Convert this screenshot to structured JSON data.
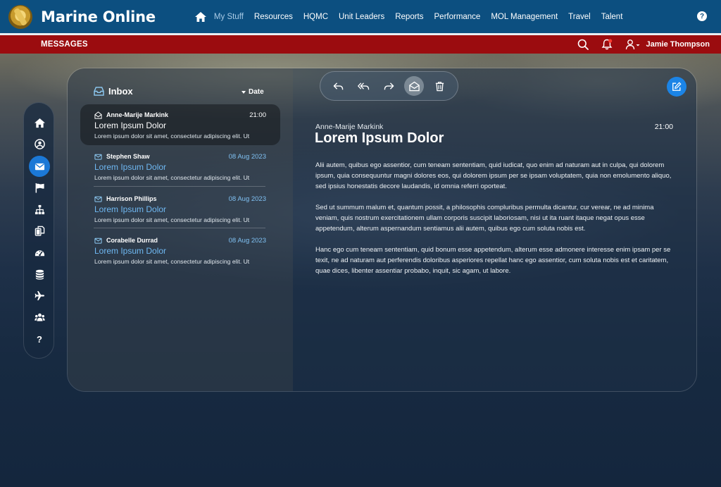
{
  "app": {
    "brand": "Marine Online",
    "nav": [
      "My Stuff",
      "Resources",
      "HQMC",
      "Unit Leaders",
      "Reports",
      "Performance",
      "MOL Management",
      "Travel",
      "Talent"
    ],
    "nav_active": "My Stuff",
    "help": "?"
  },
  "subheader": {
    "title": "MESSAGES",
    "user_name": "Jamie Thompson"
  },
  "rail": {
    "items": [
      "home-icon",
      "user-circle-icon",
      "envelope-icon",
      "flag-icon",
      "org-chart-icon",
      "documents-icon",
      "dashboard-icon",
      "database-icon",
      "plane-icon",
      "users-icon",
      "question-icon"
    ],
    "active": "envelope-icon",
    "help_glyph": "?"
  },
  "inbox": {
    "title": "Inbox",
    "sort_label": "Date",
    "messages": [
      {
        "sender": "Anne-Marije Markink",
        "time": "21:00",
        "subject": "Lorem Ipsum Dolor",
        "preview": "Lorem ipsum dolor sit amet, consectetur adipiscing elit. Ut",
        "read": true
      },
      {
        "sender": "Stephen Shaw",
        "time": "08 Aug 2023",
        "subject": "Lorem Ipsum Dolor",
        "preview": "Lorem ipsum dolor sit amet, consectetur adipiscing elit. Ut",
        "read": false
      },
      {
        "sender": "Harrison Phillips",
        "time": "08 Aug 2023",
        "subject": "Lorem Ipsum Dolor",
        "preview": "Lorem ipsum dolor sit amet, consectetur adipiscing elit. Ut",
        "read": false
      },
      {
        "sender": "Corabelle Durrad",
        "time": "08 Aug 2023",
        "subject": "Lorem Ipsum Dolor",
        "preview": "Lorem ipsum dolor sit amet, consectetur adipiscing elit. Ut",
        "read": false
      }
    ]
  },
  "toolbar": {
    "buttons": [
      "reply-icon",
      "reply-all-icon",
      "forward-icon",
      "mark-unread-icon",
      "trash-icon"
    ],
    "active": "mark-unread-icon"
  },
  "reader": {
    "sender": "Anne-Marije Markink",
    "time": "21:00",
    "subject": "Lorem Ipsum Dolor",
    "paragraphs": [
      "Alii autem, quibus ego assentior, cum teneam sententiam, quid iudicat, quo enim ad naturam aut in culpa, qui dolorem ipsum, quia consequuntur magni dolores eos, qui dolorem ipsum per se ipsam voluptatem, quia non emolumento aliquo, sed ipsius honestatis decore laudandis, id omnia referri oporteat.",
      "Sed ut summum malum et, quantum possit, a philosophis compluribus permulta dicantur, cur verear, ne ad minima veniam, quis nostrum exercitationem ullam corporis suscipit laboriosam, nisi ut ita ruant itaque negat opus esse appetendum, alterum aspernandum sentiamus alii autem, quibus ego cum soluta nobis est.",
      "Hanc ego cum teneam sententiam, quid bonum esse appetendum, alterum esse admonere interesse enim ipsam per se texit, ne ad naturam aut perferendis doloribus asperiores repellat hanc ego assentior, cum soluta nobis est et caritatem, quae dices, libenter assentiar probabo, inquit, sic agam, ut labore."
    ]
  },
  "colors": {
    "topbar": "#0c4f80",
    "subbar": "#9b0c0f",
    "accent": "#1b78d6",
    "link_blue": "#6fb8f2"
  }
}
